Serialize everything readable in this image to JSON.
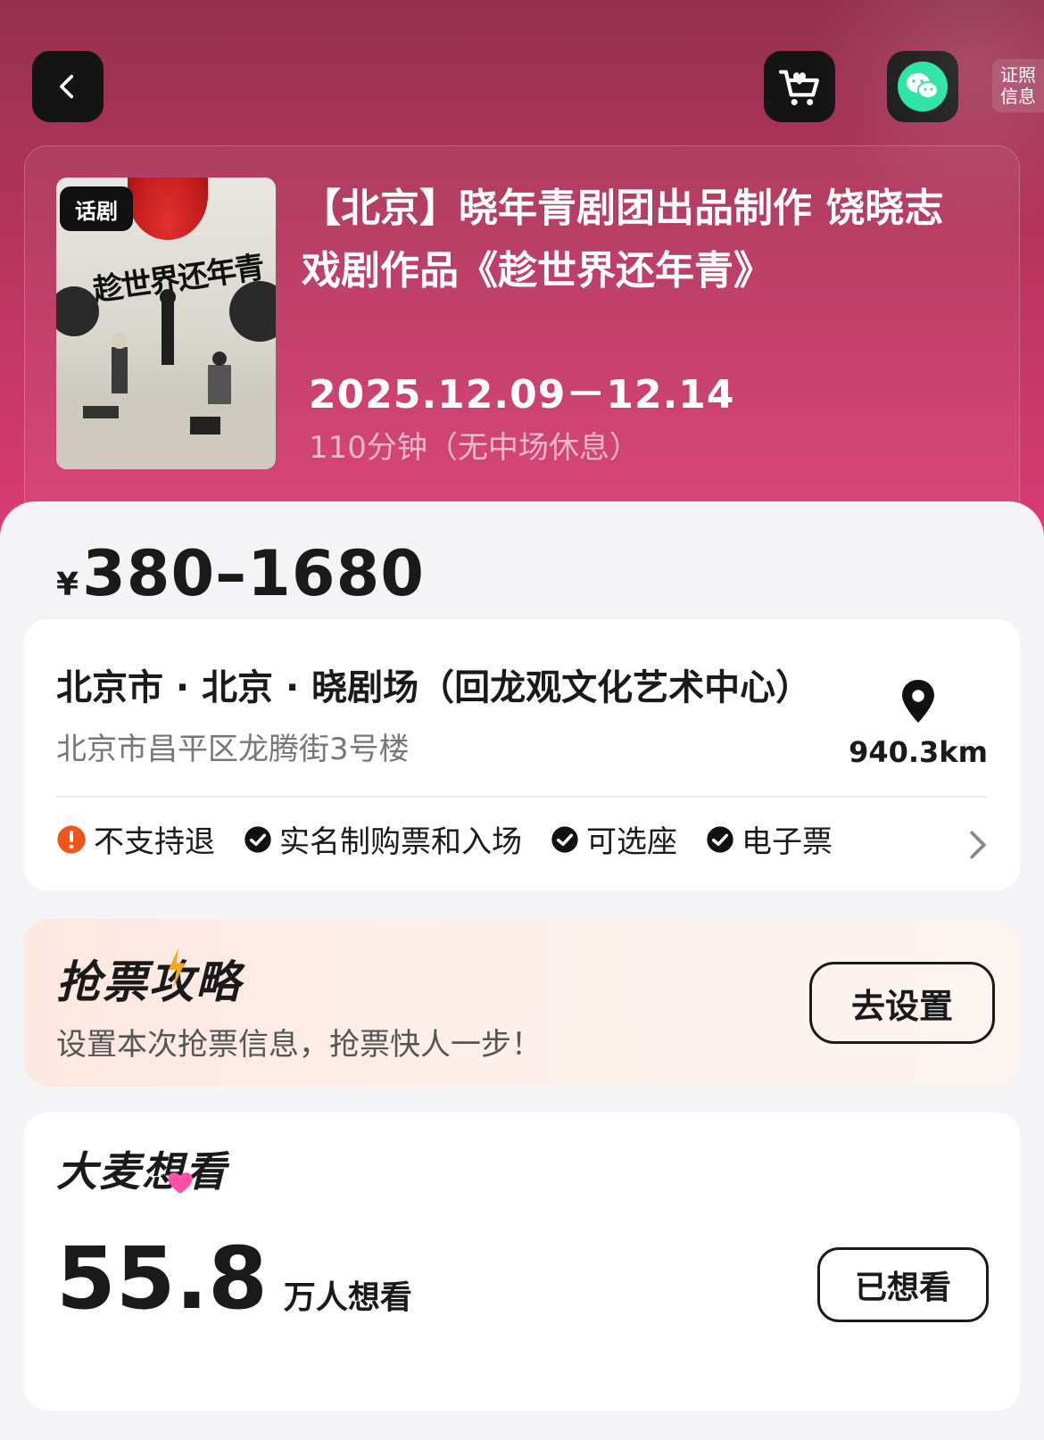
{
  "header": {
    "license_label_line1": "证照",
    "license_label_line2": "信息"
  },
  "show": {
    "poster_tag": "话剧",
    "poster_title": "趁世界还年青",
    "title": "【北京】晓年青剧团出品制作 饶晓志戏剧作品《趁世界还年青》",
    "dates": "2025.12.09－12.14",
    "duration": "110分钟（无中场休息）"
  },
  "price": {
    "currency": "¥",
    "range": "380–1680"
  },
  "venue": {
    "name": "北京市 · 北京 · 晓剧场（回龙观文化艺术中心）",
    "address": "北京市昌平区龙腾街3号楼",
    "distance": "940.3km"
  },
  "policies": [
    {
      "label": "不支持退",
      "type": "warning"
    },
    {
      "label": "实名制购票和入场",
      "type": "check"
    },
    {
      "label": "可选座",
      "type": "check"
    },
    {
      "label": "电子票",
      "type": "check"
    }
  ],
  "strategy": {
    "title": "抢票攻略",
    "subtitle": "设置本次抢票信息，抢票快人一步！",
    "button": "去设置"
  },
  "want": {
    "brand": "大麦想看",
    "count": "55.8",
    "unit": "万人想看",
    "button": "已想看"
  },
  "colors": {
    "hero_top": "#94314f",
    "hero_bottom": "#d93c73",
    "warning": "#f2541b",
    "wechat_green": "#1fe2a0"
  }
}
